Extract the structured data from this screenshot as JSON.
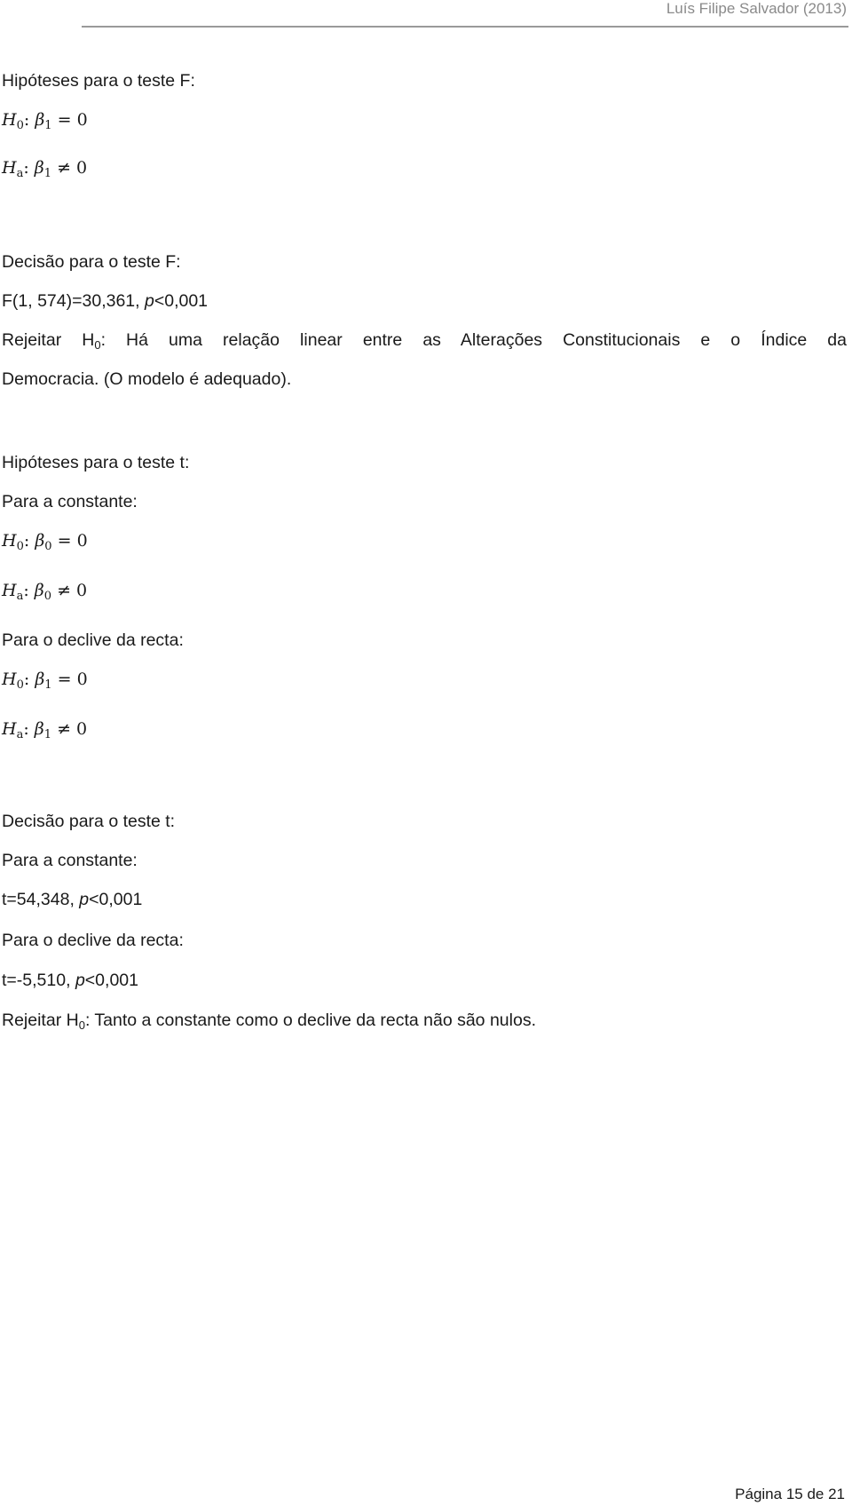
{
  "header": {
    "author": "Luís Filipe Salvador (2013)"
  },
  "f_test": {
    "hypotheses_title": "Hipóteses para o teste F:",
    "h0": {
      "H": "H",
      "Hsub": "0",
      "beta": "β",
      "bsub": "1",
      "rel": " = 0"
    },
    "ha": {
      "H": "H",
      "Hsub": "a",
      "beta": "β",
      "bsub": "1",
      "rel": " ≠ 0"
    },
    "decision_title": "Decisão para o teste F:",
    "stat_prefix": "F(1, 574)=30,361, ",
    "p_label": "p",
    "p_value": "<0,001",
    "reject_prefix": "Rejeitar H",
    "reject_sub": "0",
    "reject_text": ": Há uma relação linear entre as Alterações Constitucionais e o Índice da",
    "reject_cont": "Democracia. (O modelo é adequado)."
  },
  "t_test": {
    "hypotheses_title": "Hipóteses para o teste t:",
    "constant_label": "Para a constante:",
    "c_h0": {
      "H": "H",
      "Hsub": "0",
      "beta": "β",
      "bsub": "0",
      "rel": " = 0"
    },
    "c_ha": {
      "H": "H",
      "Hsub": "a",
      "beta": "β",
      "bsub": "0",
      "rel": " ≠ 0"
    },
    "slope_label": "Para o declive da recta:",
    "s_h0": {
      "H": "H",
      "Hsub": "0",
      "beta": "β",
      "bsub": "1",
      "rel": " = 0"
    },
    "s_ha": {
      "H": "H",
      "Hsub": "a",
      "beta": "β",
      "bsub": "1",
      "rel": " ≠ 0"
    },
    "decision_title": "Decisão para o teste t:",
    "constant_label2": "Para a constante:",
    "constant_stat": "t=54,348, ",
    "slope_label2": "Para o declive da recta:",
    "slope_stat": "t=-5,510, ",
    "p_label": "p",
    "p_value": "<0,001",
    "reject_prefix": "Rejeitar H",
    "reject_sub": "0",
    "reject_text": ": Tanto a constante como o declive da recta não são nulos."
  },
  "footer": {
    "page": "Página 15 de 21"
  }
}
